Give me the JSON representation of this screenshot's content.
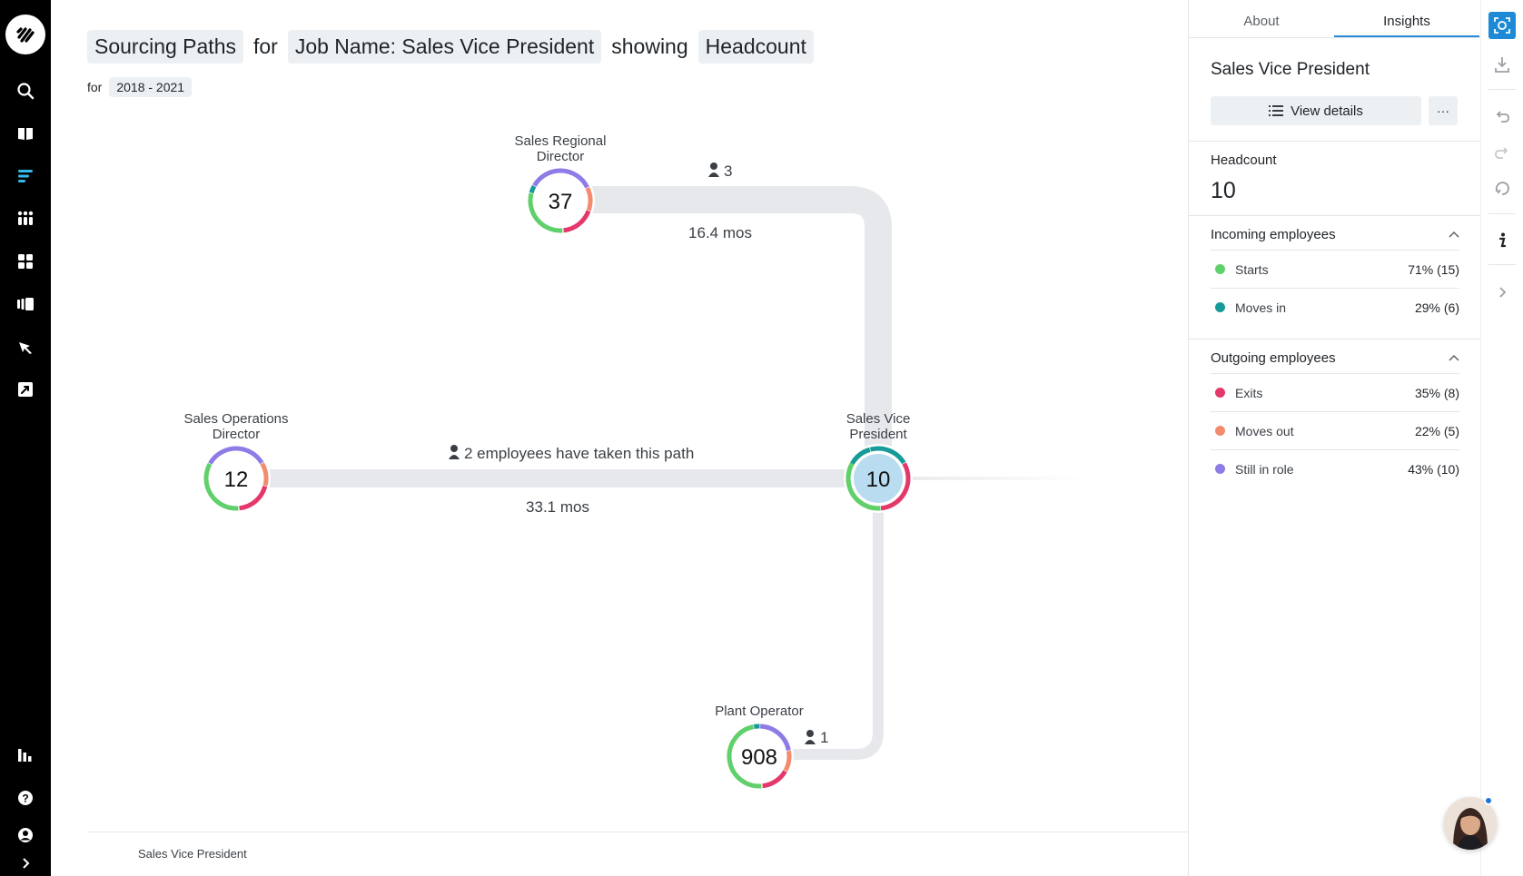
{
  "header": {
    "parts": [
      "Sourcing Paths",
      "for",
      "Job Name: Sales Vice President",
      "showing",
      "Headcount"
    ],
    "for_label": "for",
    "date_range": "2018 - 2021"
  },
  "diagram": {
    "nodes": [
      {
        "label_line1": "Sales Regional",
        "label_line2": "Director",
        "value": "37"
      },
      {
        "label_line1": "Sales Operations",
        "label_line2": "Director",
        "value": "12"
      },
      {
        "label_line1": "Sales Vice",
        "label_line2": "President",
        "value": "10"
      },
      {
        "label_line1": "Plant Operator",
        "label_line2": "",
        "value": "908"
      }
    ],
    "edges": [
      {
        "count": "3",
        "duration": "16.4 mos"
      },
      {
        "count": "2 employees have taken this path",
        "duration": "33.1 mos"
      },
      {
        "count": "1",
        "duration": ""
      }
    ]
  },
  "breadcrumb": "Sales Vice President",
  "panel": {
    "tabs": [
      "About",
      "Insights"
    ],
    "active_tab": "Insights",
    "title": "Sales Vice President",
    "view_details": "View details",
    "more": "···",
    "headcount_label": "Headcount",
    "headcount_value": "10",
    "incoming": {
      "title": "Incoming employees",
      "rows": [
        {
          "label": "Starts",
          "value": "71% (15)",
          "color": "#5fd06a"
        },
        {
          "label": "Moves in",
          "value": "29% (6)",
          "color": "#179a9a"
        }
      ]
    },
    "outgoing": {
      "title": "Outgoing employees",
      "rows": [
        {
          "label": "Exits",
          "value": "35% (8)",
          "color": "#e5386a"
        },
        {
          "label": "Moves out",
          "value": "22% (5)",
          "color": "#f38b6e"
        },
        {
          "label": "Still in role",
          "value": "43% (10)",
          "color": "#8f7be6"
        }
      ]
    }
  },
  "colors": {
    "accent": "#2a8bd8",
    "starts": "#5fd06a",
    "moves_in": "#179a9a",
    "exits": "#e5386a",
    "moves_out": "#f38b6e",
    "still_in_role": "#8f7be6",
    "path": "#e6e8eb",
    "selected_node_fill": "#b9dcf0"
  },
  "icons": {
    "leftnav": [
      "logo-icon",
      "search-icon",
      "book-icon",
      "paths-icon",
      "apps-grid-icon",
      "dashboard-icon",
      "cards-icon",
      "pen-icon",
      "export-icon",
      "bar-chart-icon",
      "help-icon",
      "user-icon",
      "chevron-right-icon"
    ],
    "toolbar": [
      "screenshot-icon",
      "download-icon",
      "undo-icon",
      "redo-icon",
      "reset-icon",
      "info-icon",
      "chevron-right-icon"
    ]
  }
}
